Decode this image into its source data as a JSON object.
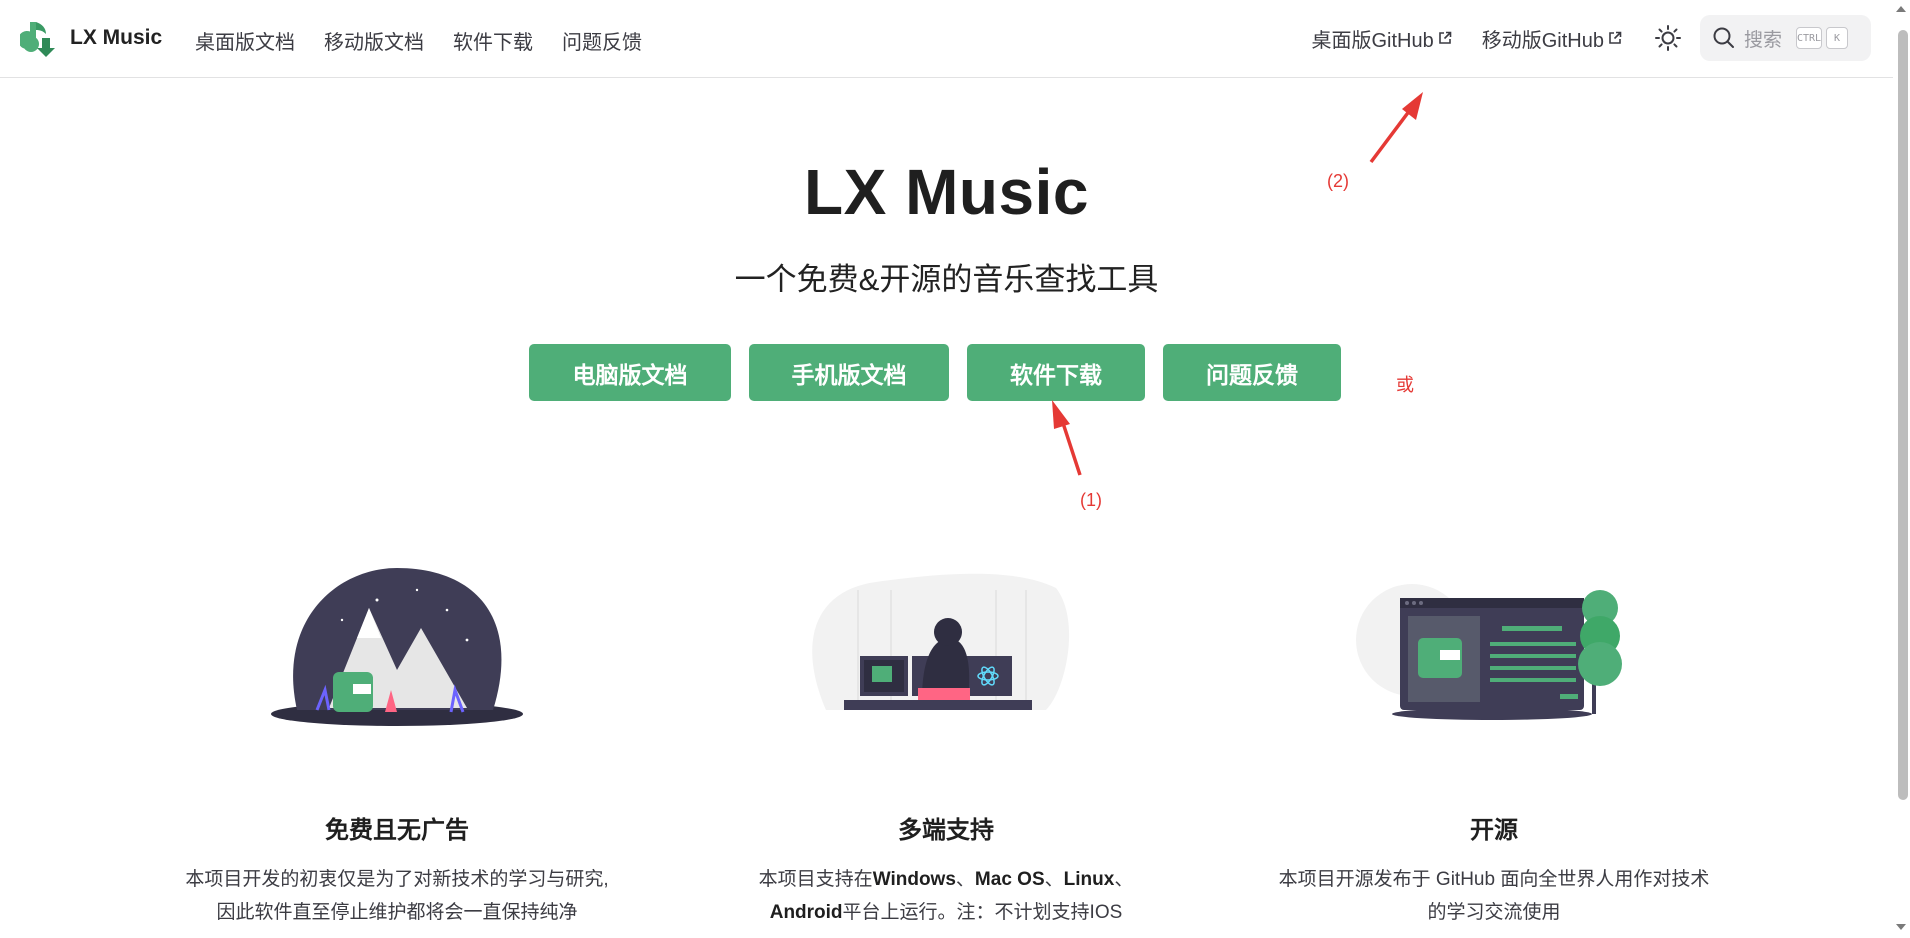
{
  "nav": {
    "brand": "LX Music",
    "links": [
      "桌面版文档",
      "移动版文档",
      "软件下载",
      "问题反馈"
    ],
    "external_links": [
      "桌面版GitHub",
      "移动版GitHub"
    ],
    "search_placeholder": "搜索",
    "search_keys": [
      "CTRL",
      "K"
    ]
  },
  "hero": {
    "title": "LX Music",
    "tagline": "一个免费&开源的音乐查找工具",
    "actions": [
      "电脑版文档",
      "手机版文档",
      "软件下载",
      "问题反馈"
    ]
  },
  "annotations": {
    "label_1": "(1)",
    "label_2": "(2)",
    "or": "或"
  },
  "features": [
    {
      "title": "免费且无广告",
      "desc_line1": "本项目开发的初衷仅是为了对新技术的学习与研究,",
      "desc_line2": "因此软件直至停止维护都将会一直保持纯净"
    },
    {
      "title": "多端支持",
      "desc_a": "本项目支持在",
      "desc_b": "Windows",
      "desc_c": "、",
      "desc_d": "Mac OS",
      "desc_e": "、",
      "desc_f": "Linux",
      "desc_g": "、",
      "desc_h": "Android",
      "desc_i": "平台上运行。注：不计划支持IOS"
    },
    {
      "title": "开源",
      "desc_line1": "本项目开源发布于 GitHub 面向全世界人用作对技术",
      "desc_line2": "的学习交流使用"
    }
  ],
  "colors": {
    "brand_green": "#4fae78",
    "annotation_red": "#e53935"
  }
}
